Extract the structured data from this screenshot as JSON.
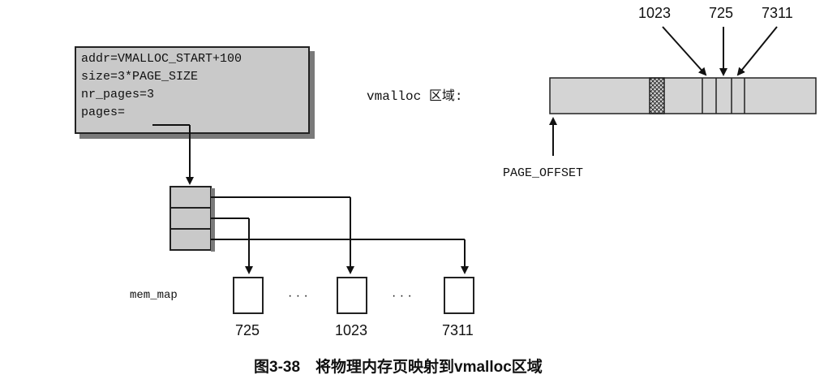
{
  "vm_struct": {
    "lines": [
      "addr=VMALLOC_START+100",
      "size=3*PAGE_SIZE",
      "nr_pages=3",
      "pages="
    ]
  },
  "vmalloc_region": {
    "label": "vmalloc 区域:",
    "page_offset_label": "PAGE_OFFSET",
    "top_labels": [
      "1023",
      "725",
      "7311"
    ]
  },
  "mem_map": {
    "label": "mem_map",
    "pages": [
      "725",
      "1023",
      "7311"
    ],
    "ellipsis": "· · ·"
  },
  "caption": "图3-38　将物理内存页映射到vmalloc区域"
}
